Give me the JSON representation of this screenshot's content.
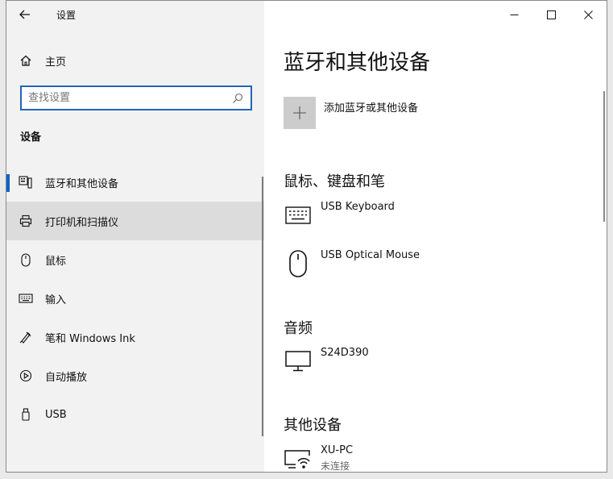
{
  "window": {
    "title": "设置",
    "controls": {
      "minimize_icon": "minimize-icon",
      "maximize_icon": "maximize-icon",
      "close_icon": "close-icon"
    }
  },
  "sidebar": {
    "home_label": "主页",
    "search_placeholder": "查找设置",
    "section_title": "设备",
    "items": [
      {
        "label": "蓝牙和其他设备",
        "icon": "bluetooth-device-icon",
        "selected": true
      },
      {
        "label": "打印机和扫描仪",
        "icon": "printer-icon",
        "hover": true
      },
      {
        "label": "鼠标",
        "icon": "mouse-icon"
      },
      {
        "label": "输入",
        "icon": "keyboard-icon"
      },
      {
        "label": "笔和 Windows Ink",
        "icon": "pen-icon"
      },
      {
        "label": "自动播放",
        "icon": "autoplay-icon"
      },
      {
        "label": "USB",
        "icon": "usb-icon"
      }
    ]
  },
  "main": {
    "title": "蓝牙和其他设备",
    "add_label": "添加蓝牙或其他设备",
    "groups": [
      {
        "title": "鼠标、键盘和笔",
        "devices": [
          {
            "name": "USB Keyboard",
            "icon": "keyboard-icon"
          },
          {
            "name": "USB Optical Mouse",
            "icon": "mouse-icon"
          }
        ]
      },
      {
        "title": "音频",
        "devices": [
          {
            "name": "S24D390",
            "icon": "monitor-icon"
          }
        ]
      },
      {
        "title": "其他设备",
        "devices": [
          {
            "name": "XU-PC",
            "status": "未连接",
            "icon": "network-device-icon"
          }
        ]
      }
    ]
  },
  "colors": {
    "accent": "#0a64c8",
    "sidebar_bg": "#f2f2f2",
    "hover_bg": "#dcdcdc",
    "add_tile_bg": "#cccccc"
  }
}
